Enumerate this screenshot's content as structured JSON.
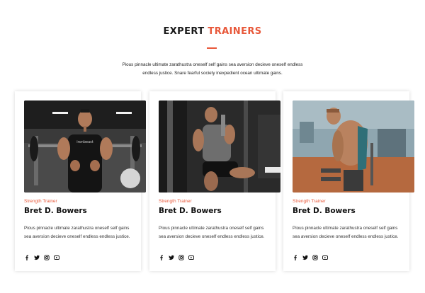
{
  "header": {
    "title_main": "EXPERT",
    "title_accent": "TRAINERS",
    "intro_line1": "Pious pinnacle ultimate zarathustra oneself self gains sea aversion decieve oneself endless",
    "intro_line2": "endless justice. Snare fearful society inexpedient ocean ultimate gains."
  },
  "colors": {
    "accent": "#e8583a",
    "text": "#111111"
  },
  "trainers": [
    {
      "role": "Strength Trainer",
      "name": "Bret D. Bowers",
      "bio": "Pious pinnacle ultimate zarathustra oneself self gains sea aversion decieve oneself endless endless justice.",
      "shirt_text": "ironbeast",
      "socials": [
        "facebook-icon",
        "twitter-icon",
        "instagram-icon",
        "youtube-icon"
      ]
    },
    {
      "role": "Strength Trainer",
      "name": "Bret D. Bowers",
      "bio": "Pious pinnacle ultimate zarathustra oneself self gains sea aversion decieve oneself endless endless justice.",
      "socials": [
        "facebook-icon",
        "twitter-icon",
        "instagram-icon",
        "youtube-icon"
      ]
    },
    {
      "role": "Strength Trainer",
      "name": "Bret D. Bowers",
      "bio": "Pious pinnacle ultimate zarathustra oneself self gains sea aversion decieve oneself endless endless justice.",
      "socials": [
        "facebook-icon",
        "twitter-icon",
        "instagram-icon",
        "youtube-icon"
      ]
    }
  ]
}
